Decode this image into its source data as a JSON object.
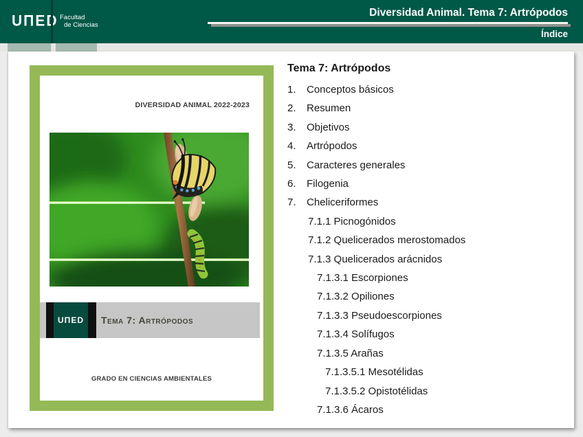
{
  "header": {
    "logo_text": "UΠED",
    "faculty_line1": "Facultad",
    "faculty_line2": "de Ciencias",
    "title": "Diversidad Animal. Tema 7: Artrópodos",
    "page_label": "Índice"
  },
  "cover": {
    "top_title": "DIVERSIDAD ANIMAL 2022-2023",
    "logo_text": "UΠED",
    "band_title": "Tema 7: Artrópodos",
    "footer": "GRADO EN CIENCIAS AMBIENTALES"
  },
  "toc": {
    "heading": "Tema 7: Artrópodos",
    "items": [
      {
        "num": "1.",
        "text": "Conceptos básicos",
        "level": 0
      },
      {
        "num": "2.",
        "text": "Resumen",
        "level": 0
      },
      {
        "num": "3.",
        "text": "Objetivos",
        "level": 0
      },
      {
        "num": "4.",
        "text": "Artrópodos",
        "level": 0
      },
      {
        "num": "5.",
        "text": "Caracteres generales",
        "level": 0
      },
      {
        "num": "6.",
        "text": "Filogenia",
        "level": 0
      },
      {
        "num": "7.",
        "text": "Cheliceriformes",
        "level": 0
      },
      {
        "num": "",
        "text": "7.1.1 Picnogónidos",
        "level": 1
      },
      {
        "num": "",
        "text": "7.1.2 Quelicerados merostomados",
        "level": 1
      },
      {
        "num": "",
        "text": "7.1.3 Quelicerados arácnidos",
        "level": 1
      },
      {
        "num": "",
        "text": "7.1.3.1 Escorpiones",
        "level": 2
      },
      {
        "num": "",
        "text": "7.1.3.2 Opiliones",
        "level": 2
      },
      {
        "num": "",
        "text": "7.1.3.3 Pseudoescorpiones",
        "level": 2
      },
      {
        "num": "",
        "text": "7.1.3.4 Solífugos",
        "level": 2
      },
      {
        "num": "",
        "text": "7.1.3.5 Arañas",
        "level": 2
      },
      {
        "num": "",
        "text": "7.1.3.5.1 Mesotélidas",
        "level": 3
      },
      {
        "num": "",
        "text": "7.1.3.5.2 Opistotélidas",
        "level": 3
      },
      {
        "num": "",
        "text": "7.1.3.6 Ácaros",
        "level": 2
      }
    ]
  },
  "colors": {
    "header_green": "#005847",
    "sage": "#a5bab0",
    "cover_green": "#95b957",
    "band_gray": "#c6c6c6",
    "logo_green": "#074a3e"
  }
}
